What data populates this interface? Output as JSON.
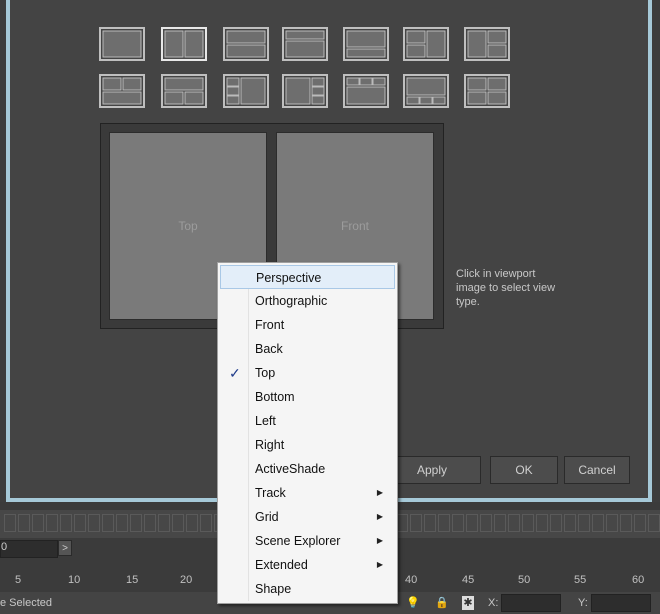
{
  "viewports": {
    "left_label": "Top",
    "right_label": "Front"
  },
  "hint": "Click in viewport image to select view type.",
  "buttons": {
    "apply": "Apply",
    "ok": "OK",
    "cancel": "Cancel"
  },
  "context_menu": {
    "items": [
      {
        "label": "Perspective",
        "highlighted": true
      },
      {
        "label": "Orthographic"
      },
      {
        "label": "Front"
      },
      {
        "label": "Back"
      },
      {
        "label": "Top",
        "checked": true
      },
      {
        "label": "Bottom"
      },
      {
        "label": "Left"
      },
      {
        "label": "Right"
      },
      {
        "label": "ActiveShade"
      },
      {
        "label": "Track",
        "submenu": true
      },
      {
        "label": "Grid",
        "submenu": true
      },
      {
        "label": "Scene Explorer",
        "submenu": true
      },
      {
        "label": "Extended",
        "submenu": true
      },
      {
        "label": "Shape"
      }
    ]
  },
  "timeline": {
    "frame_value": "0",
    "next_label": ">",
    "ticks": [
      "5",
      "10",
      "15",
      "20",
      "40",
      "45",
      "50",
      "55",
      "60"
    ]
  },
  "status_bar": {
    "selection_text": "e Selected",
    "x_label": "X:",
    "y_label": "Y:"
  },
  "icons": {
    "check": "checkmark-icon",
    "submenu": "submenu-arrow-icon",
    "light": "lightbulb-icon",
    "lock": "lock-icon",
    "snap": "selection-snap-icon"
  },
  "colors": {
    "dialog_border": "#a6c9d8",
    "menu_highlight": "#e3eef9",
    "check": "#1f3b8a"
  }
}
